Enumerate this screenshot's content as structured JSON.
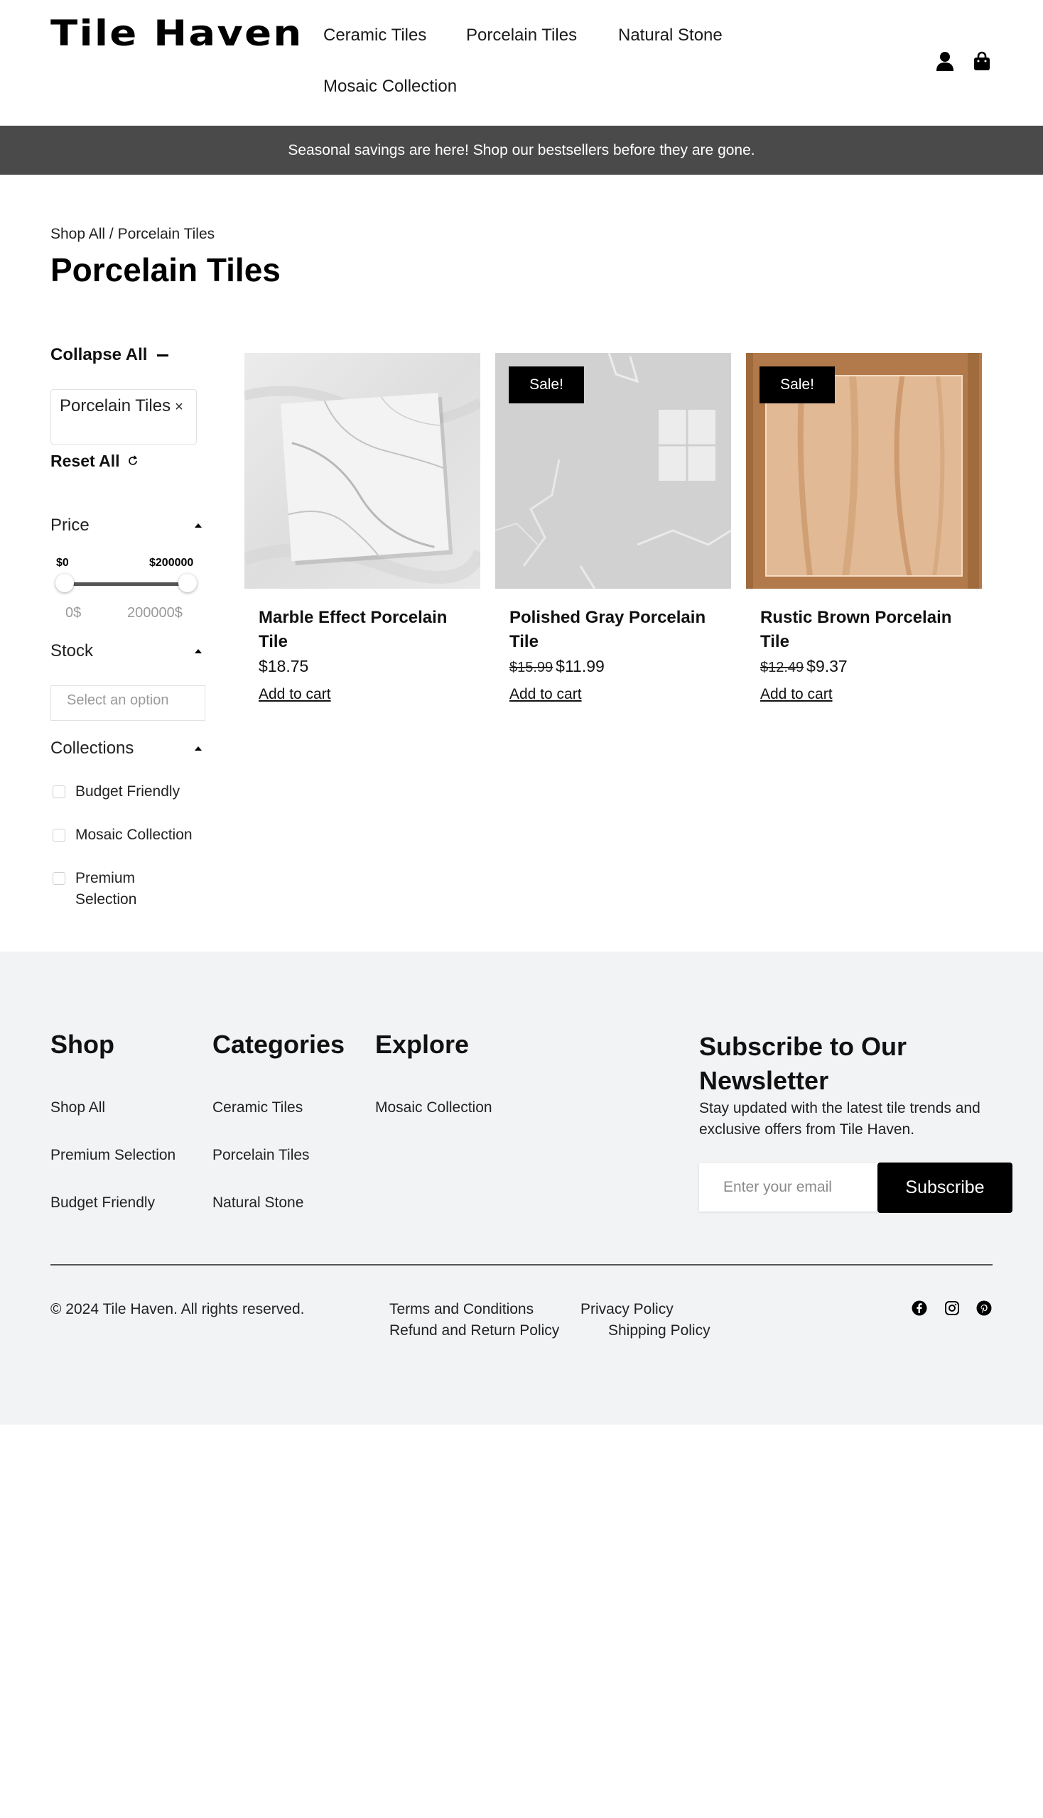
{
  "header": {
    "logo": "Tile Haven",
    "nav": [
      "Ceramic Tiles",
      "Porcelain Tiles",
      "Natural Stone",
      "Mosaic Collection"
    ],
    "icons": [
      "user-icon",
      "shopping-bag-icon"
    ]
  },
  "announcement": "Seasonal savings are here! Shop our bestsellers before they are gone.",
  "breadcrumb": {
    "root": "Shop All",
    "separator": " / ",
    "current": "Porcelain Tiles"
  },
  "page_title": "Porcelain Tiles",
  "filters": {
    "collapse_all": "Collapse All",
    "active_chip": "Porcelain Tiles",
    "chip_remove": "×",
    "reset_all": "Reset All",
    "price": {
      "label": "Price",
      "min_label": "$0",
      "max_label": "$200000",
      "min_value": "0$",
      "max_value": "200000$",
      "range_low": 0,
      "range_high": 200000
    },
    "stock": {
      "label": "Stock",
      "placeholder": "Select an option"
    },
    "collections": {
      "label": "Collections",
      "options": [
        "Budget Friendly",
        "Mosaic Collection",
        "Premium Selection"
      ]
    }
  },
  "products": [
    {
      "name": "Marble Effect Porcelain Tile",
      "price": "$18.75",
      "old_price": "",
      "sale": false,
      "add_to_cart": "Add to cart"
    },
    {
      "name": "Polished Gray Porcelain Tile",
      "price": "$11.99",
      "old_price": "$15.99",
      "sale": true,
      "sale_label": "Sale!",
      "add_to_cart": "Add to cart"
    },
    {
      "name": "Rustic Brown Porcelain Tile",
      "price": "$9.37",
      "old_price": "$12.49",
      "sale": true,
      "sale_label": "Sale!",
      "add_to_cart": "Add to cart"
    }
  ],
  "footer": {
    "shop": {
      "title": "Shop",
      "links": [
        "Shop All",
        "Premium Selection",
        "Budget Friendly"
      ]
    },
    "categories": {
      "title": "Categories",
      "links": [
        "Ceramic Tiles",
        "Porcelain Tiles",
        "Natural Stone"
      ]
    },
    "explore": {
      "title": "Explore",
      "links": [
        "Mosaic Collection"
      ]
    },
    "newsletter": {
      "title": "Subscribe to Our Newsletter",
      "description": "Stay updated with the latest tile trends and exclusive offers from Tile Haven.",
      "placeholder": "Enter your email",
      "button": "Subscribe"
    },
    "copyright": "© 2024 Tile Haven. All rights reserved.",
    "legal": [
      "Terms and Conditions",
      "Privacy Policy",
      "Refund and Return Policy",
      "Shipping Policy"
    ],
    "social": [
      "facebook-icon",
      "instagram-icon",
      "pinterest-icon"
    ]
  },
  "colors": {
    "announcement_bg": "#4a4a4a",
    "footer_bg": "#f2f3f5",
    "sale_badge": "#000000",
    "button": "#000000"
  }
}
